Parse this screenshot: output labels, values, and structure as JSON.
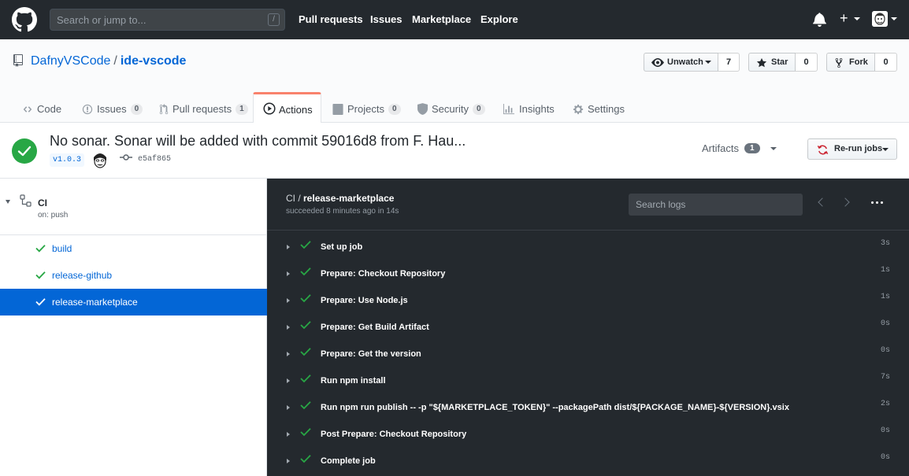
{
  "header": {
    "search_placeholder": "Search or jump to...",
    "search_shortcut": "/",
    "nav": [
      "Pull requests",
      "Issues",
      "Marketplace",
      "Explore"
    ],
    "plus": "+"
  },
  "repo": {
    "owner": "DafnyVSCode",
    "separator": "/",
    "name": "ide-vscode",
    "unwatch_label": "Unwatch",
    "unwatch_count": "7",
    "star_label": "Star",
    "star_count": "0",
    "fork_label": "Fork",
    "fork_count": "0",
    "tabs": [
      {
        "label": "Code",
        "icon": "code-icon"
      },
      {
        "label": "Issues",
        "count": "0",
        "icon": "issue-icon"
      },
      {
        "label": "Pull requests",
        "count": "1",
        "icon": "pull-request-icon"
      },
      {
        "label": "Actions",
        "icon": "play-icon",
        "active": true
      },
      {
        "label": "Projects",
        "count": "0",
        "icon": "project-icon"
      },
      {
        "label": "Security",
        "count": "0",
        "icon": "shield-icon"
      },
      {
        "label": "Insights",
        "icon": "graph-icon"
      },
      {
        "label": "Settings",
        "icon": "gear-icon"
      }
    ]
  },
  "run": {
    "title": "No sonar. Sonar will be added with commit 59016d8 from F. Hau...",
    "tag": "v1.0.3",
    "sha": "e5af865",
    "artifacts_label": "Artifacts",
    "artifacts_count": "1",
    "rerun_label": "Re-run jobs"
  },
  "sidebar": {
    "workflow_name": "CI",
    "workflow_trigger": "on: push",
    "jobs": [
      {
        "label": "build",
        "selected": false
      },
      {
        "label": "release-github",
        "selected": false
      },
      {
        "label": "release-marketplace",
        "selected": true
      }
    ]
  },
  "log": {
    "title_prefix": "CI /",
    "title_job": "release-marketplace",
    "subtitle": "succeeded 8 minutes ago in 14s",
    "search_placeholder": "Search logs",
    "steps": [
      {
        "label": "Set up job",
        "duration": "3s"
      },
      {
        "label": "Prepare: Checkout Repository",
        "duration": "1s"
      },
      {
        "label": "Prepare: Use Node.js",
        "duration": "1s"
      },
      {
        "label": "Prepare: Get Build Artifact",
        "duration": "0s"
      },
      {
        "label": "Prepare: Get the version",
        "duration": "0s"
      },
      {
        "label": "Run npm install",
        "duration": "7s"
      },
      {
        "label": "Run npm run publish -- -p \"${MARKETPLACE_TOKEN}\" --packagePath dist/${PACKAGE_NAME}-${VERSION}.vsix",
        "duration": "2s"
      },
      {
        "label": "Post Prepare: Checkout Repository",
        "duration": "0s"
      },
      {
        "label": "Complete job",
        "duration": "0s"
      }
    ]
  },
  "colors": {
    "header_bg": "#24292e",
    "link": "#0366d6",
    "success": "#28a745",
    "active_tab_border": "#f9826c",
    "log_bg": "#24292e"
  }
}
